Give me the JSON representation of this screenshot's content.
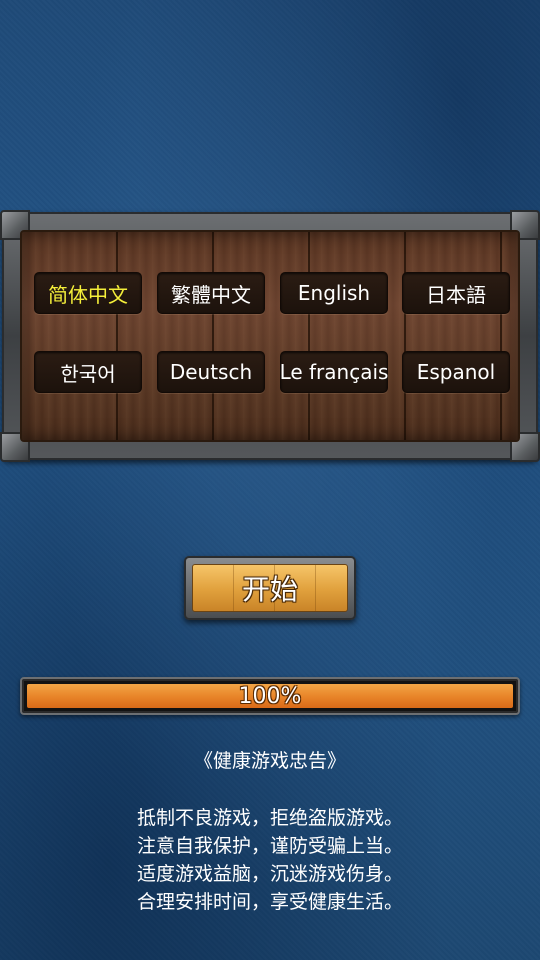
{
  "languages": [
    {
      "label": "简体中文",
      "selected": true
    },
    {
      "label": "繁體中文",
      "selected": false
    },
    {
      "label": "English",
      "selected": false
    },
    {
      "label": "日本語",
      "selected": false
    },
    {
      "label": "한국어",
      "selected": false
    },
    {
      "label": "Deutsch",
      "selected": false
    },
    {
      "label": "Le français",
      "selected": false
    },
    {
      "label": "Espanol",
      "selected": false
    }
  ],
  "start_button": {
    "label": "开始"
  },
  "progress": {
    "label": "100%",
    "value": 1.0
  },
  "advisory": {
    "title": "《健康游戏忠告》",
    "lines": [
      "抵制不良游戏，拒绝盗版游戏。",
      "注意自我保护，谨防受骗上当。",
      "适度游戏益脑，沉迷游戏伤身。",
      "合理安排时间，享受健康生活。"
    ]
  },
  "colors": {
    "background": "#24578a",
    "selected_language": "#f5ef3a",
    "progress_fill": "#e9862a",
    "start_button": "#e0a03c"
  }
}
